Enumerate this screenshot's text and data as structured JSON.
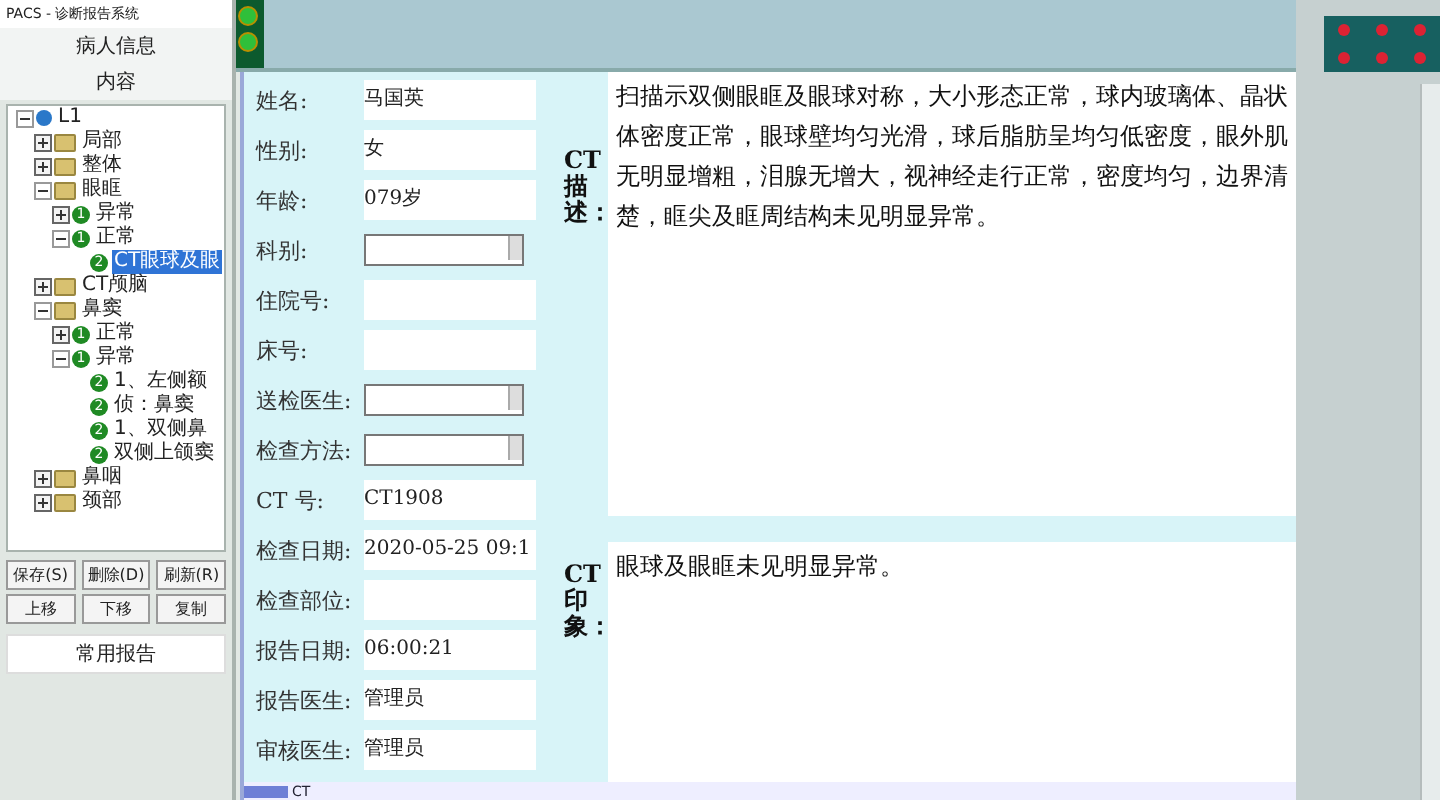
{
  "window": {
    "title": "PACS - 诊断报告系统"
  },
  "sidebar": {
    "header": "病人信息",
    "subheader": "内容",
    "tree": [
      {
        "label": "L1",
        "kind": "root",
        "expanded": true,
        "selected": false,
        "children": [
          {
            "label": "局部",
            "kind": "folder",
            "expanded": false,
            "selected": false
          },
          {
            "label": "整体",
            "kind": "folder",
            "expanded": false,
            "selected": false
          },
          {
            "label": "眼眶",
            "kind": "folder",
            "expanded": true,
            "selected": false,
            "children": [
              {
                "label": "异常",
                "kind": "badge",
                "badge": "1",
                "expanded": false,
                "selected": false
              },
              {
                "label": "正常",
                "kind": "badge",
                "badge": "1",
                "expanded": true,
                "selected": false,
                "children": [
                  {
                    "label": "CT眼球及眼",
                    "kind": "badge",
                    "badge": "2",
                    "selected": true
                  }
                ]
              }
            ]
          },
          {
            "label": "CT颅脑",
            "kind": "folder",
            "expanded": false,
            "selected": false
          },
          {
            "label": "鼻窦",
            "kind": "folder",
            "expanded": true,
            "selected": false,
            "children": [
              {
                "label": "正常",
                "kind": "badge",
                "badge": "1",
                "expanded": false,
                "selected": false
              },
              {
                "label": "异常",
                "kind": "badge",
                "badge": "1",
                "expanded": true,
                "selected": false,
                "children": [
                  {
                    "label": "1、左侧额",
                    "kind": "badge",
                    "badge": "2",
                    "selected": false
                  },
                  {
                    "label": "侦：鼻窦",
                    "kind": "badge",
                    "badge": "2",
                    "selected": false
                  },
                  {
                    "label": "1、双侧鼻",
                    "kind": "badge",
                    "badge": "2",
                    "selected": false
                  },
                  {
                    "label": "双侧上颌窦",
                    "kind": "badge",
                    "badge": "2",
                    "selected": false
                  }
                ]
              }
            ]
          },
          {
            "label": "鼻咽",
            "kind": "folder",
            "expanded": false,
            "selected": false
          },
          {
            "label": "颈部",
            "kind": "folder",
            "expanded": false,
            "selected": false
          }
        ]
      }
    ],
    "buttons": [
      [
        "保存(S)",
        "删除(D)",
        "刷新(R)"
      ],
      [
        "上移",
        "下移",
        "复制"
      ]
    ],
    "common_button": "常用报告"
  },
  "form": {
    "fields": [
      {
        "label": "姓名:",
        "kind": "text",
        "value": "马国英"
      },
      {
        "label": "性别:",
        "kind": "text",
        "value": "女"
      },
      {
        "label": "年龄:",
        "kind": "text",
        "value": "079岁"
      },
      {
        "label": "科别:",
        "kind": "select"
      },
      {
        "label": "住院号:",
        "kind": "text"
      },
      {
        "label": "床号:",
        "kind": "text"
      },
      {
        "label": "送检医生:",
        "kind": "select"
      },
      {
        "label": "检查方法:",
        "kind": "select"
      },
      {
        "label": "CT 号:",
        "kind": "text",
        "value": "CT1908"
      },
      {
        "label": "检查日期:",
        "kind": "text",
        "value": "2020-05-25 09:1"
      },
      {
        "label": "检查部位:",
        "kind": "text"
      },
      {
        "label": "报告日期:",
        "kind": "text",
        "value": " 06:00:21"
      },
      {
        "label": "报告医生:",
        "kind": "text",
        "value": "管理员"
      },
      {
        "label": "审核医生:",
        "kind": "text",
        "value": "管理员"
      }
    ]
  },
  "description": {
    "label": "CT描述：",
    "text": "扫描示双侧眼眶及眼球对称，大小形态正常，球内玻璃体、晶状体密度正常，眼球壁均匀光滑，球后脂肪呈均匀低密度，眼外肌无明显增粗，泪腺无增大，视神经走行正常，密度均匀，边界清楚，眶尖及眶周结构未见明显异常。"
  },
  "impression": {
    "label": "CT印象：",
    "text": "眼球及眼眶未见明显异常。"
  },
  "sheet_tab": "CT"
}
